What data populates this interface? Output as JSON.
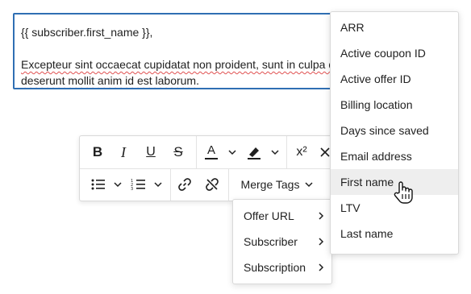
{
  "editor": {
    "line1": "{{ subscriber.first_name }},",
    "line2": "Excepteur sint occaecat cupidatat non proident, sunt in culpa qui officia",
    "line3": "deserunt mollit anim id est laborum."
  },
  "toolbar": {
    "bold": "B",
    "italic": "I",
    "underline": "U",
    "strikethrough": "S",
    "text_color": "A",
    "superscript": "x²",
    "merge_tags_label": "Merge Tags"
  },
  "merge_submenu": {
    "items": [
      {
        "label": "Offer URL"
      },
      {
        "label": "Subscriber"
      },
      {
        "label": "Subscription"
      }
    ]
  },
  "subscriber_menu": {
    "items": [
      {
        "label": "ARR"
      },
      {
        "label": "Active coupon ID"
      },
      {
        "label": "Active offer ID"
      },
      {
        "label": "Billing location"
      },
      {
        "label": "Days since saved"
      },
      {
        "label": "Email address"
      },
      {
        "label": "First name",
        "hovered": true
      },
      {
        "label": "LTV"
      },
      {
        "label": "Last name"
      }
    ]
  },
  "colors": {
    "editor_border": "#2f6fb3",
    "hover_bg": "#eeeeee",
    "spellcheck": "#e05050"
  }
}
